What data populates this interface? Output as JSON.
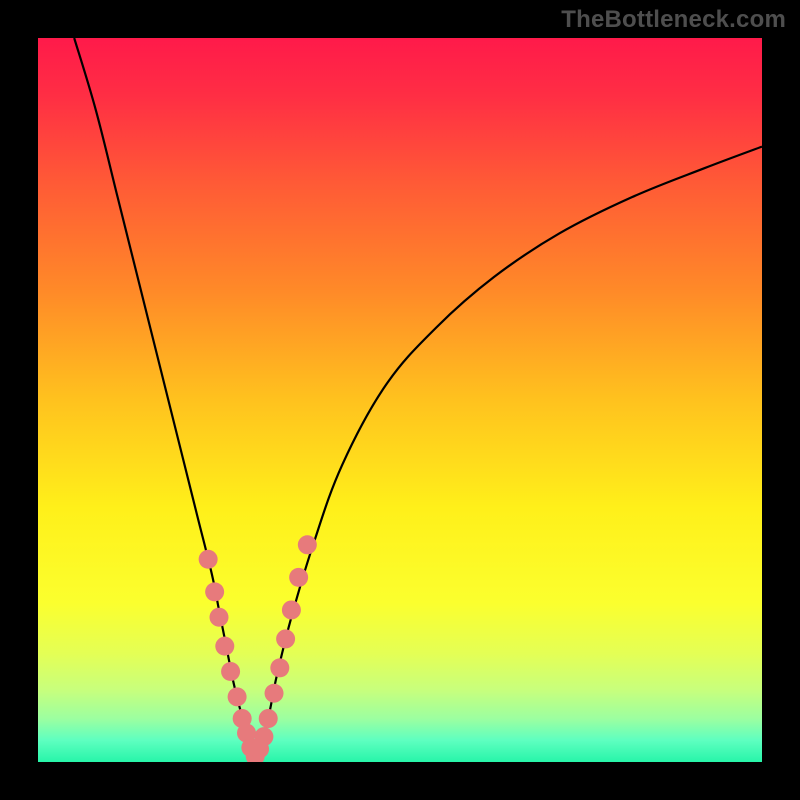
{
  "watermark": "TheBottleneck.com",
  "colors": {
    "frame": "#000000",
    "watermark": "#4e4e4e",
    "curve": "#000000",
    "markers_fill": "#e77a7c",
    "markers_stroke": "#cc5d5f",
    "gradient": {
      "stops": [
        {
          "offset": 0.0,
          "color": "#ff1a4a"
        },
        {
          "offset": 0.08,
          "color": "#ff2e44"
        },
        {
          "offset": 0.2,
          "color": "#ff5a36"
        },
        {
          "offset": 0.35,
          "color": "#ff8a28"
        },
        {
          "offset": 0.5,
          "color": "#ffc21e"
        },
        {
          "offset": 0.65,
          "color": "#fff01a"
        },
        {
          "offset": 0.78,
          "color": "#fbff2e"
        },
        {
          "offset": 0.85,
          "color": "#e4ff55"
        },
        {
          "offset": 0.9,
          "color": "#c8ff7c"
        },
        {
          "offset": 0.94,
          "color": "#9cffa0"
        },
        {
          "offset": 0.97,
          "color": "#5effc0"
        },
        {
          "offset": 1.0,
          "color": "#27f5a9"
        }
      ]
    }
  },
  "chart_data": {
    "type": "line",
    "title": "",
    "xlabel": "",
    "ylabel": "",
    "xlim": [
      0,
      100
    ],
    "ylim": [
      0,
      100
    ],
    "legend": false,
    "grid": false,
    "series": [
      {
        "name": "left-branch",
        "x": [
          5,
          8,
          11,
          14,
          17,
          20,
          22,
          24,
          25,
          26,
          27,
          28,
          29,
          29.5,
          30
        ],
        "y": [
          100,
          90,
          78,
          66,
          54,
          42,
          34,
          26,
          21,
          16,
          11,
          7,
          4,
          2,
          0
        ]
      },
      {
        "name": "right-branch",
        "x": [
          30,
          31,
          32,
          33,
          35,
          38,
          42,
          48,
          55,
          63,
          72,
          82,
          92,
          100
        ],
        "y": [
          0,
          3,
          7,
          12,
          20,
          30,
          41,
          52,
          60,
          67,
          73,
          78,
          82,
          85
        ]
      }
    ],
    "markers": {
      "name": "highlight-points",
      "x": [
        23.5,
        24.4,
        25.0,
        25.8,
        26.6,
        27.5,
        28.2,
        28.8,
        29.4,
        30.0,
        30.6,
        31.2,
        31.8,
        32.6,
        33.4,
        34.2,
        35.0,
        36.0,
        37.2
      ],
      "y": [
        28.0,
        23.5,
        20.0,
        16.0,
        12.5,
        9.0,
        6.0,
        4.0,
        2.0,
        0.8,
        1.8,
        3.5,
        6.0,
        9.5,
        13.0,
        17.0,
        21.0,
        25.5,
        30.0
      ]
    }
  }
}
